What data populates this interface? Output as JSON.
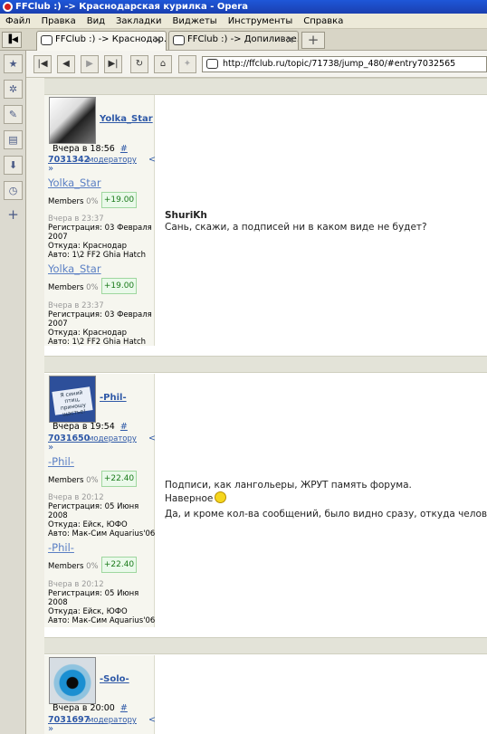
{
  "window": {
    "title": "FFClub :) -> Краснодарская курилка - Opera"
  },
  "menu": [
    "Файл",
    "Правка",
    "Вид",
    "Закладки",
    "Виджеты",
    "Инструменты",
    "Справка"
  ],
  "tabs": [
    {
      "label": "FFClub :) -> Краснодар...",
      "active": true
    },
    {
      "label": "FFClub :) -> Допиливае...",
      "active": false
    }
  ],
  "address": {
    "url": "http://ffclub.ru/topic/71738/jump_480/#entry7032565"
  },
  "nav_icons": [
    "first-icon",
    "back-icon",
    "forward-icon",
    "last-icon",
    "reload-icon",
    "home-icon",
    "wand-icon"
  ],
  "panel_icons": [
    "bookmarks-icon",
    "widgets-icon",
    "notes-icon",
    "downloads-icon",
    "history-icon",
    "add-panel-icon"
  ],
  "posts": [
    {
      "username": "Yolka_Star",
      "time": "Вчера в 18:56",
      "hash": "#",
      "post_id": "7031342",
      "to_moderator": "модератору",
      "lt": "<",
      "raquo": "»",
      "nick": "Yolka_Star",
      "members": "Members",
      "pct": "0%",
      "rep": "+19.00",
      "last": "Вчера в 23:37",
      "reg": "Регистрация: 03 Февраля",
      "reg_year": "2007",
      "from": "Откуда: Краснодар",
      "auto": "Авто: 1\\2 FF2 Ghia Hatch",
      "message": {
        "quote_author": "ShuriKh",
        "lines": [
          "Сань, скажи, а подписей ни в каком виде не будет?"
        ]
      }
    },
    {
      "username": "-Phil-",
      "time": "Вчера в 19:54",
      "hash": "#",
      "post_id": "7031650",
      "to_moderator": "модератору",
      "lt": "<",
      "raquo": "»",
      "avatar_text": "Я синий птиц, приношу щастье!",
      "nick": "-Phil-",
      "members": "Members",
      "pct": "0%",
      "rep": "+22.40",
      "last": "Вчера в 20:12",
      "reg": "Регистрация: 05 Июня",
      "reg_year": "2008",
      "from": "Откуда: Ейск, ЮФО",
      "auto": "Авто: Мак-Сим Aquarius'06",
      "message": {
        "lines": [
          "Подписи, как лангольеры, ЖРУТ память форума.",
          "Наверное",
          "Да, и кроме кол-ва сообщений, было видно сразу, откуда человек."
        ]
      }
    },
    {
      "username": "-Solo-",
      "time": "Вчера в 20:00",
      "hash": "#",
      "post_id": "7031697",
      "to_moderator": "модератору",
      "lt": "<",
      "raquo": "»"
    }
  ]
}
